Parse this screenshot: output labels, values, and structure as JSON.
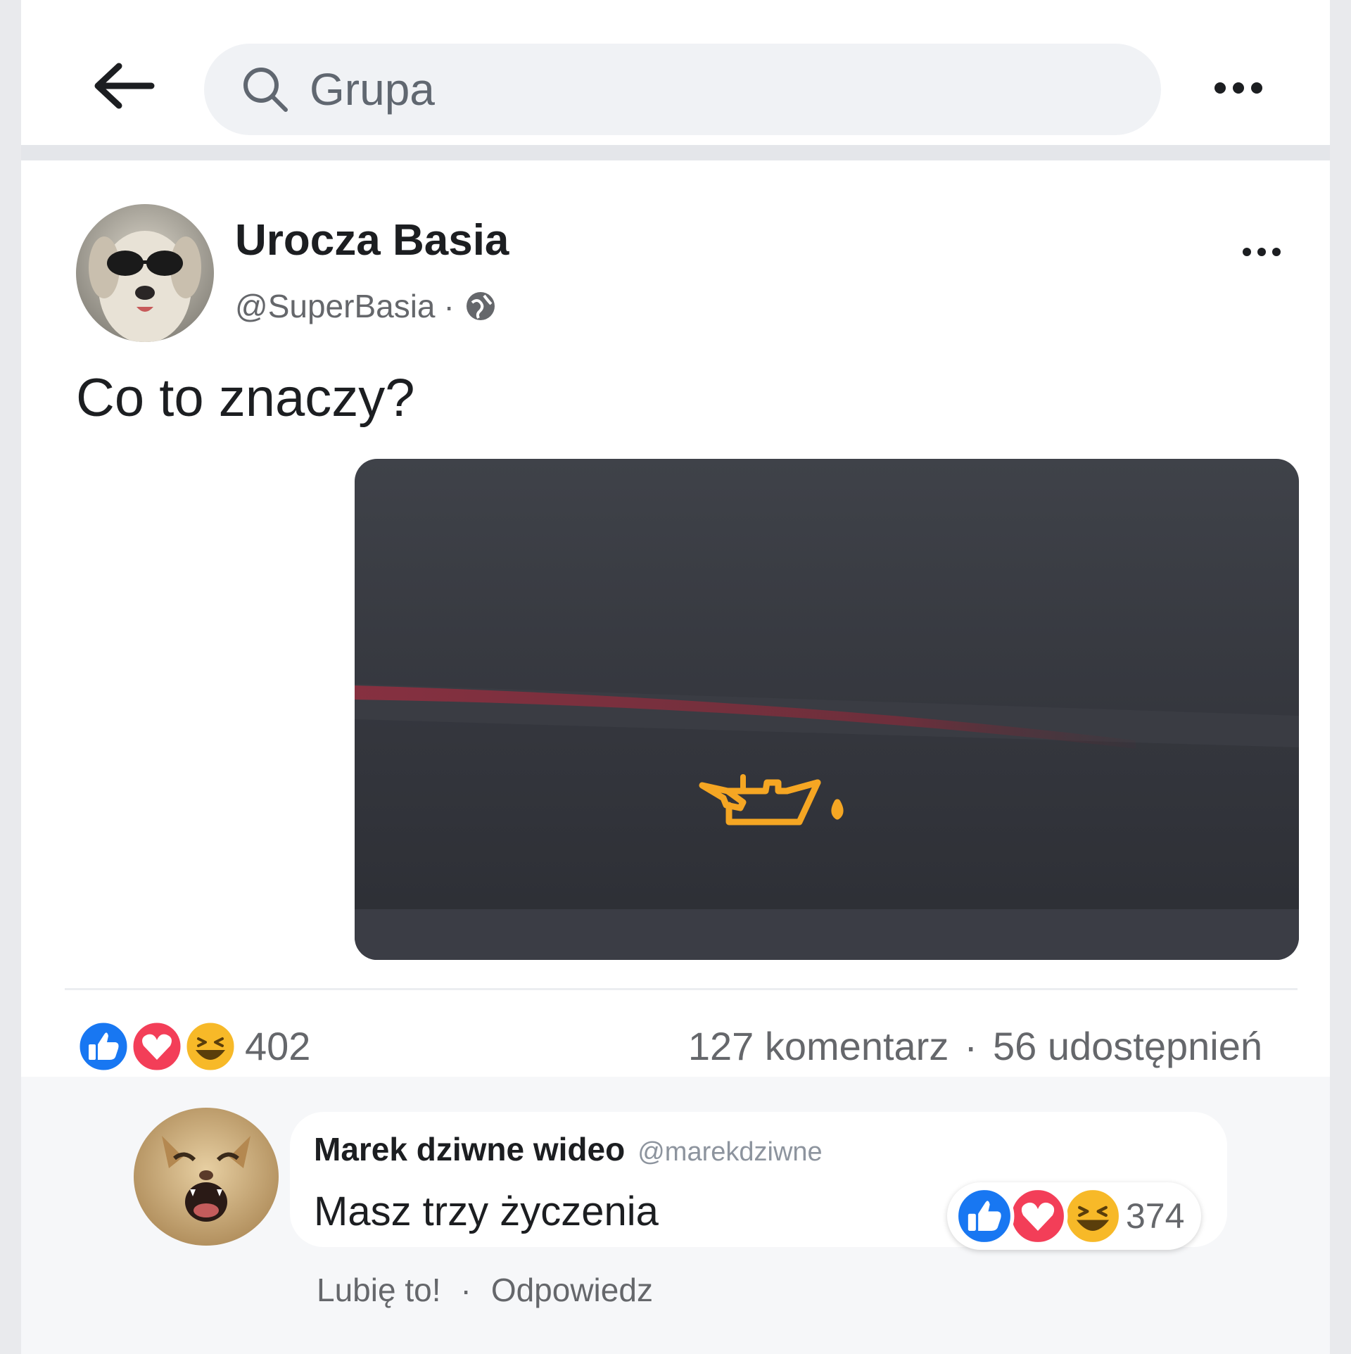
{
  "search": {
    "placeholder": "Grupa"
  },
  "post": {
    "author": "Urocza Basia",
    "handle": "@SuperBasia",
    "separator": "·",
    "text": "Co to znaczy?",
    "reactions_count": "402",
    "comments": "127 komentarz",
    "stats_separator": "·",
    "shares": "56 udostępnień"
  },
  "comment": {
    "author": "Marek dziwne wideo",
    "handle": "@marekdziwne",
    "text": "Masz trzy życzenia",
    "reactions_count": "374",
    "like_label": "Lubię to!",
    "separator": "·",
    "reply_label": "Odpowiedz"
  },
  "colors": {
    "like_blue": "#1877f2",
    "love_red": "#f33e58",
    "haha_yellow": "#f7b928",
    "warning_amber": "#f5a623"
  },
  "icons": {
    "back": "arrow-left-icon",
    "search": "search-icon",
    "more": "more-horizontal-icon",
    "privacy": "globe-icon",
    "reactions": [
      "like-icon",
      "love-icon",
      "haha-icon"
    ],
    "image_symbol": "oil-pressure-warning-icon"
  }
}
